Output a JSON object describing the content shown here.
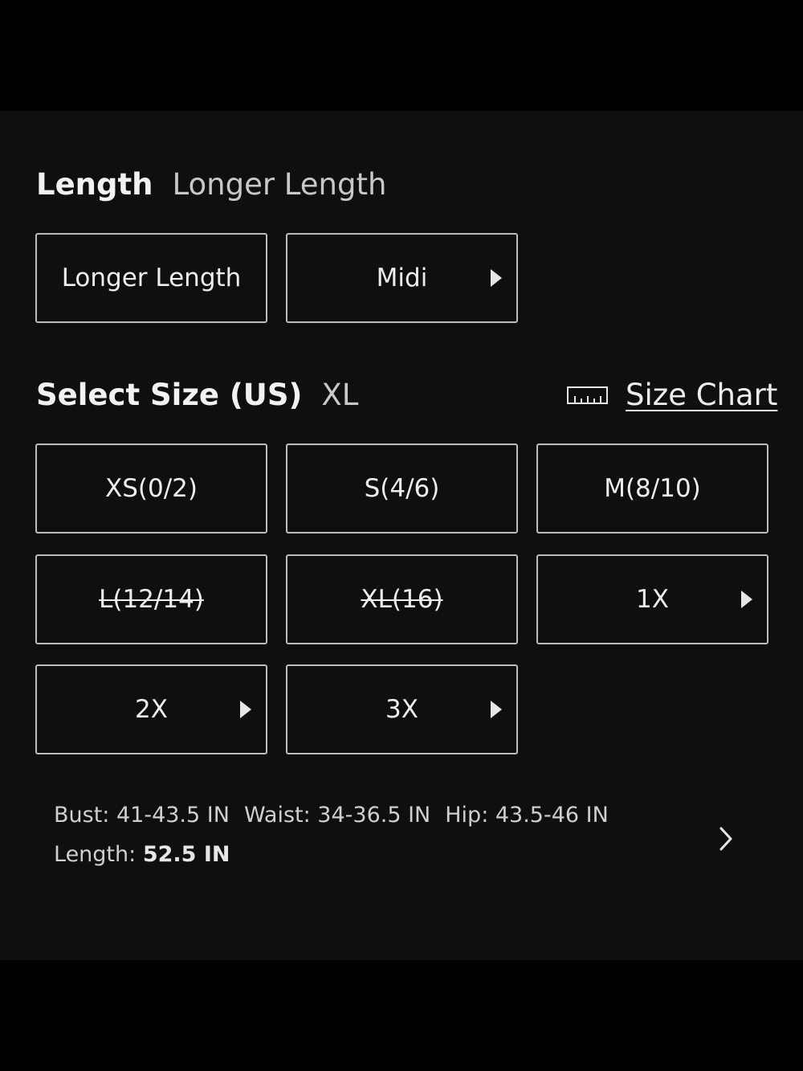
{
  "length_section": {
    "title": "Length",
    "selected_value": "Longer Length",
    "options": [
      {
        "label": "Longer Length",
        "has_arrow": false
      },
      {
        "label": "Midi",
        "has_arrow": true
      }
    ]
  },
  "size_section": {
    "title": "Select Size (US)",
    "selected_value": "XL",
    "size_chart_icon": "ruler-icon",
    "size_chart_label": "Size Chart",
    "options": [
      {
        "label": "XS(0/2)",
        "unavailable": false,
        "has_arrow": false
      },
      {
        "label": "S(4/6)",
        "unavailable": false,
        "has_arrow": false
      },
      {
        "label": "M(8/10)",
        "unavailable": false,
        "has_arrow": false
      },
      {
        "label": "L(12/14)",
        "unavailable": true,
        "has_arrow": false
      },
      {
        "label": "XL(16)",
        "unavailable": true,
        "has_arrow": false
      },
      {
        "label": "1X",
        "unavailable": false,
        "has_arrow": true
      },
      {
        "label": "2X",
        "unavailable": false,
        "has_arrow": true
      },
      {
        "label": "3X",
        "unavailable": false,
        "has_arrow": true
      }
    ]
  },
  "measurements": {
    "bust": "Bust: 41-43.5 IN",
    "waist": "Waist: 34-36.5 IN",
    "hip": "Hip: 43.5-46 IN",
    "length_label": "Length:",
    "length_value": "52.5 IN",
    "more_icon": "chevron-right-icon"
  },
  "colors": {
    "background": "#0f0f0f",
    "border": "#bdbdbd",
    "text": "#ededed"
  }
}
